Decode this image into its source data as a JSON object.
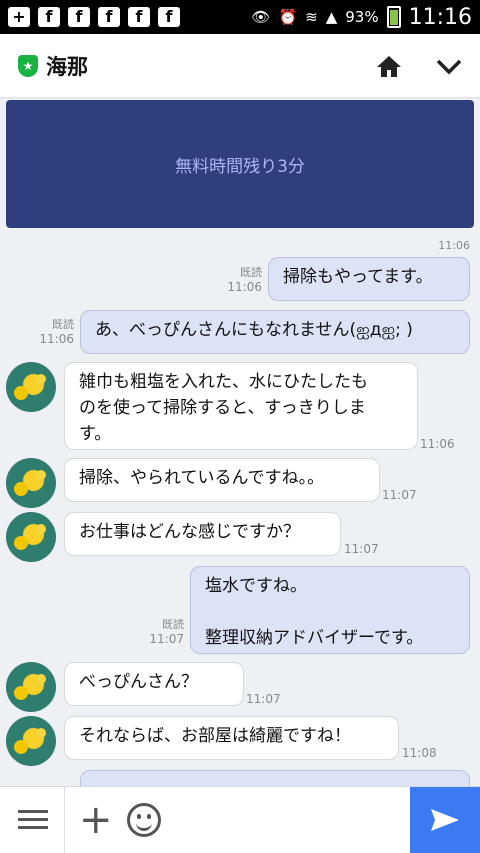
{
  "status_bar": {
    "battery": "93%",
    "time": "11:16",
    "notif_icons": [
      "plus-box-icon",
      "facebook-icon",
      "facebook-icon",
      "facebook-icon",
      "facebook-icon",
      "facebook-icon"
    ]
  },
  "header": {
    "title": "海那"
  },
  "banner": {
    "text": "無料時間残り3分"
  },
  "messages": [
    {
      "side": "out",
      "read": "既読",
      "time": "11:06",
      "text": "掃除もやってます。"
    },
    {
      "side": "out",
      "read": "既読",
      "time": "11:06",
      "text": "あ、べっぴんさんにもなれません(ஐдஐ; )"
    },
    {
      "side": "in",
      "time": "11:06",
      "lines": [
        "雑巾も粗塩を入れた、水にひたしたも",
        "のを使って掃除すると、すっきりしま",
        "す。"
      ]
    },
    {
      "side": "in",
      "time": "11:07",
      "text": "掃除、やられているんですね。。"
    },
    {
      "side": "in",
      "time": "11:07",
      "text": "お仕事はどんな感じですか？"
    },
    {
      "side": "out",
      "read": "既読",
      "time": "11:07",
      "lines": [
        "塩水ですね。",
        "",
        "整理収納アドバイザーです。"
      ]
    },
    {
      "side": "in",
      "time": "11:07",
      "text": "べっぴんさん？"
    },
    {
      "side": "in",
      "time": "11:08",
      "text": "それならば、お部屋は綺麗ですね！"
    }
  ],
  "top_time": "11:06",
  "colors": {
    "accent": "#3a7af2",
    "banner": "#2f3f7d",
    "out_bubble": "#dce3f6"
  }
}
